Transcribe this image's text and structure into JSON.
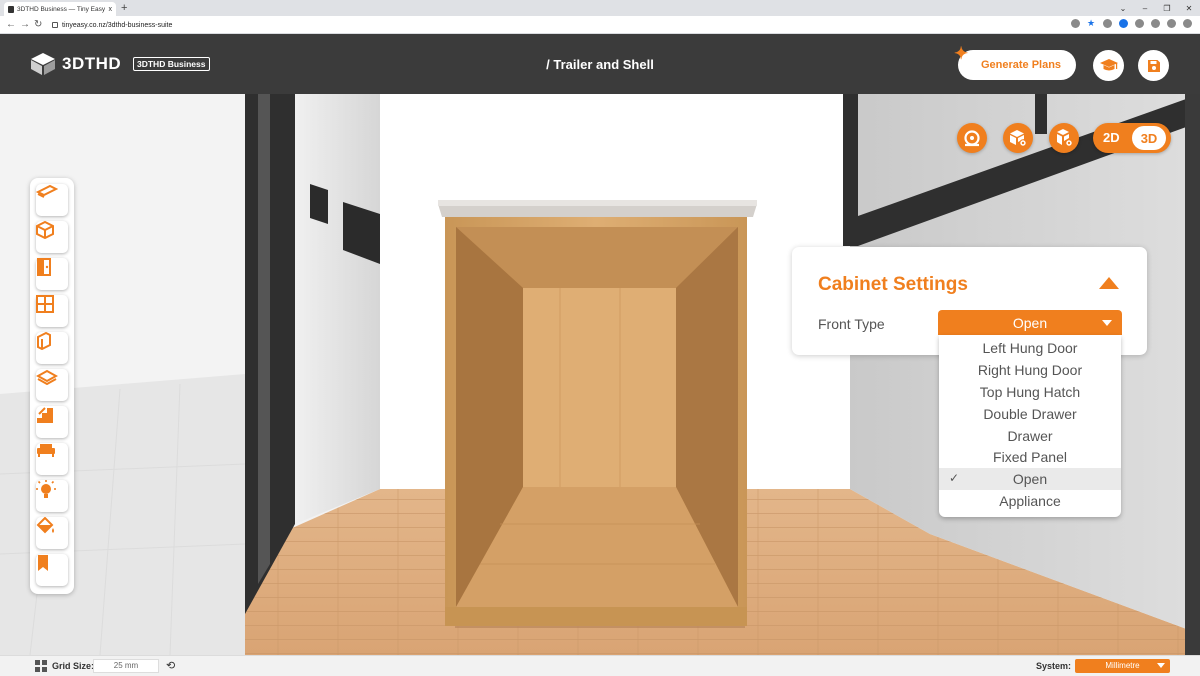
{
  "browser": {
    "tab_title": "3DTHD Business — Tiny Easy - T",
    "tab_close": "x",
    "new_tab": "+",
    "url": "tinyeasy.co.nz/3dthd-business-suite",
    "window_controls": [
      "⌄",
      "–",
      "❐",
      "✕"
    ]
  },
  "header": {
    "logo_text": "3DTHD",
    "badge": "3DTHD Business",
    "title": "/ Trailer and Shell",
    "generate_label": "Generate Plans",
    "icons": [
      "graduation-cap-icon",
      "save-icon"
    ]
  },
  "view_controls": {
    "icons": [
      "tape-measure-icon",
      "hide-walls-icon",
      "hide-roof-icon"
    ],
    "mode_2d": "2D",
    "mode_3d": "3D",
    "active_mode": "3D"
  },
  "tools": [
    "floor-tool-icon",
    "box-tool-icon",
    "door-tool-icon",
    "window-tool-icon",
    "wall-panel-tool-icon",
    "ceiling-tool-icon",
    "stairs-tool-icon",
    "furniture-tool-icon",
    "lighting-tool-icon",
    "paint-tool-icon",
    "bookmark-tool-icon"
  ],
  "settings": {
    "title": "Cabinet Settings",
    "front_type_label": "Front Type",
    "front_type_value": "Open",
    "options": [
      {
        "label": "Left Hung Door",
        "selected": false
      },
      {
        "label": "Right Hung Door",
        "selected": false
      },
      {
        "label": "Top Hung Hatch",
        "selected": false
      },
      {
        "label": "Double Drawer",
        "selected": false
      },
      {
        "label": "Drawer",
        "selected": false
      },
      {
        "label": "Fixed Panel",
        "selected": false
      },
      {
        "label": "Open",
        "selected": true
      },
      {
        "label": "Appliance",
        "selected": false
      }
    ],
    "check_mark": "✓"
  },
  "status": {
    "grid_label": "Grid Size:",
    "grid_value": "25 mm",
    "reset_icon": "⟲",
    "system_label": "System:",
    "system_value": "Millimetre"
  },
  "colors": {
    "accent": "#f07f1e",
    "header_bg": "#3b3b3b",
    "wood": "#d9a66b"
  }
}
